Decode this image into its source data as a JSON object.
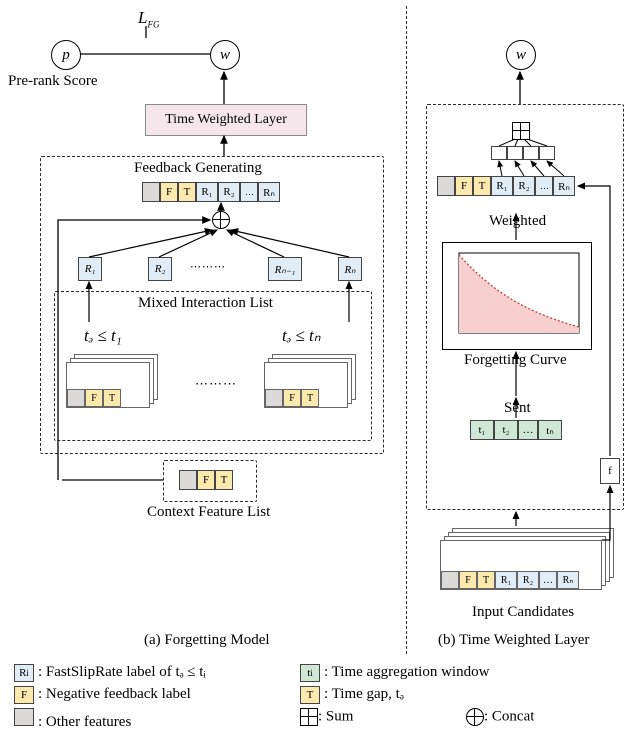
{
  "top": {
    "loss": "L",
    "loss_sub": "FG",
    "p": "p",
    "p_label": "Pre-rank Score",
    "w": "w",
    "twl": "Time Weighted Layer"
  },
  "a": {
    "feedback_gen": "Feedback Generating",
    "row": {
      "g": "",
      "F": "F",
      "T": "T",
      "r1": "R₁",
      "r2": "R₂",
      "dots": "…",
      "rn": "Rₙ"
    },
    "nodes": {
      "r1": "R₁",
      "r2": "R₂",
      "rn1": "Rₙ₋₁",
      "rn": "Rₙ",
      "dots": "⋯⋯⋯"
    },
    "mixlist": "Mixed Interaction List",
    "cond1": "tₔ ≤ t₁",
    "condn": "tₔ ≤ tₙ",
    "dots": "⋯⋯⋯",
    "context_row": {
      "g": "",
      "F": "F",
      "T": "T"
    },
    "context_label": "Context Feature List",
    "caption": "(a) Forgetting Model"
  },
  "b": {
    "w": "w",
    "row": {
      "g": "",
      "F": "F",
      "T": "T",
      "r1": "R₁",
      "r2": "R₂",
      "dots": "…",
      "rn": "Rₙ"
    },
    "weighted": "Weighted",
    "forgetting": "Forgetting Curve",
    "sent": "Sent",
    "times": {
      "t1": "t₁",
      "t2": "t₂",
      "dots": "…",
      "tn": "tₙ"
    },
    "f": "f",
    "input_label": "Input Candidates",
    "input_row": {
      "g": "",
      "F": "F",
      "T": "T",
      "r1": "R₁",
      "r2": "R₂",
      "dots": "…",
      "rn": "Rₙ"
    },
    "caption": "(b) Time Weighted Layer"
  },
  "legend": {
    "ri": "R",
    "ri_sub": "i",
    "ri_desc": ": FastSlipRate label of tₔ ≤ tᵢ",
    "f": "F",
    "f_desc": ": Negative feedback label",
    "other": "",
    "other_desc": ": Other features",
    "ti": "t",
    "ti_sub": "i",
    "ti_desc": ": Time aggregation window",
    "t": "T",
    "t_desc": ": Time gap,  tₔ",
    "sum": ": Sum",
    "concat": ": Concat"
  },
  "chart_data": {
    "type": "line",
    "title": "Forgetting Curve",
    "description": "Monotonically decreasing exponential-like curve, area under curve shaded light red/pink.",
    "x": [
      0,
      0.2,
      0.4,
      0.6,
      0.8,
      1.0
    ],
    "y": [
      1.0,
      0.58,
      0.37,
      0.25,
      0.18,
      0.13
    ],
    "xlabel": "",
    "ylabel": "",
    "xlim": [
      0,
      1
    ],
    "ylim": [
      0,
      1
    ]
  }
}
